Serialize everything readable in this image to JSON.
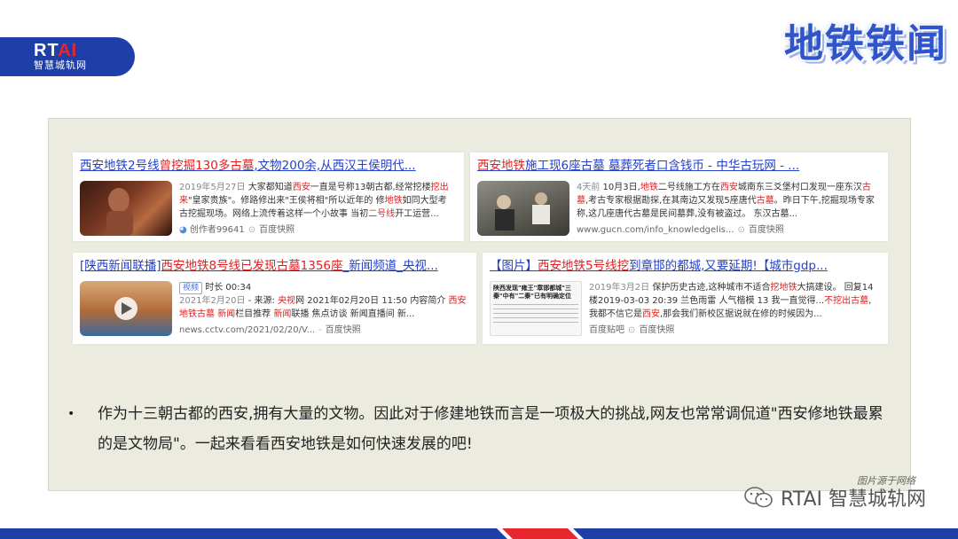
{
  "logo": {
    "rt": "RT",
    "ai": "AI",
    "sub": "智慧城轨网"
  },
  "title": "地铁铁闻",
  "cards": [
    {
      "title_pre": "西安地铁2号线",
      "title_hl": "曾挖掘130多古墓",
      "title_post": ",文物200余,从西汉王侯明代...",
      "date": "2019年5月27日",
      "s1": " 大家都知道",
      "s1_hl": "西安",
      "s2": "一直是号称13朝古都,经常挖楼",
      "s2_hl": "挖出来",
      "s3": "\"皇家贵族\"。修路修出来\"王侯将相\"所以近年的 修",
      "s3_hl": "地铁",
      "s4": "如同大型考古挖掘现场。网络上流传着这样一个小故事 当初",
      "s4_hl": "二号线",
      "s5": "开工运营...",
      "meta_author": "创作者99641",
      "meta_src": "百度快照"
    },
    {
      "title_pre": "西安地铁",
      "title_hl": "施工现6座古墓",
      "title_post": " 墓葬死者口含钱币 - 中华古玩网 - ...",
      "date": "4天前",
      "s1": " 10月3日,",
      "s1_hl": "地铁",
      "s2": "二号线施工方在",
      "s2_hl": "西安",
      "s3": "城南东三爻堡村口发现一座东汉",
      "s3_hl": "古墓",
      "s4": ",考古专家根据勘探,在其南边又发现5座唐代",
      "s4_hl": "古墓",
      "s5": "。昨日下午,挖掘现场专家称,这几座唐代古墓是民间墓葬,没有被盗过。 东汉古墓...",
      "meta_author": "www.gucn.com/info_knowledgelis...",
      "meta_src": "百度快照"
    },
    {
      "title_pre": "[陕西新闻联播]",
      "title_hl": "西安地铁8号线已发现古墓1356座",
      "title_post": "_新闻频道_央视...",
      "tag": "视频",
      "duration": "时长 00:34",
      "date": "2021年2月20日",
      "s1": " - 来源: ",
      "s1_hl": "央视",
      "s2": "网 2021年02月20日 11:50 内容简介 ",
      "s2_hl": "西安地铁古墓",
      "s3": " ",
      "s3_hl": "新闻",
      "s4": "栏目推荐 ",
      "s4_hl": "新闻",
      "s5": "联播 焦点访谈 新闻直播间 新...",
      "meta_author": "news.cctv.com/2021/02/20/V...",
      "meta_src": "百度快照"
    },
    {
      "title_pre": "【图片】",
      "title_hl": "西安地铁5号线挖",
      "title_post": "到章邯的都城,又要延期!【城市gdp...",
      "thumb_text": "陕西发现\"雍王\"章邯都城\"三秦\"中有\"二秦\"已有明确定位",
      "date": "2019年3月2日",
      "s1": " 保护历史古迹,这种城市不适合",
      "s1_hl": "挖地铁",
      "s2": "大搞建设。 回复14楼2019-03-03 20:39 兰色雨雷 人气楷模 13 我一直觉得...",
      "s2_hl": "不挖出古墓",
      "s3": ",我都不信它是",
      "s3_hl": "西安",
      "s4": ",那会我们新校区据说就在修的时候因为...",
      "s4_hl": "",
      "s5": "",
      "meta_author": "百度贴吧",
      "meta_src": "百度快照"
    }
  ],
  "bullet": "作为十三朝古都的西安,拥有大量的文物。因此对于修建地铁而言是一项极大的挑战,网友也常常调侃道\"西安修地铁最累的是文物局\"。一起来看看西安地铁是如何快速发展的吧!",
  "credit": "图片源于网络",
  "watermark": "RTAI 智慧城轨网",
  "colors": {
    "brand": "#1f3fa8",
    "accent": "#e8262d",
    "link": "#2440c8",
    "highlight": "#e02020"
  }
}
